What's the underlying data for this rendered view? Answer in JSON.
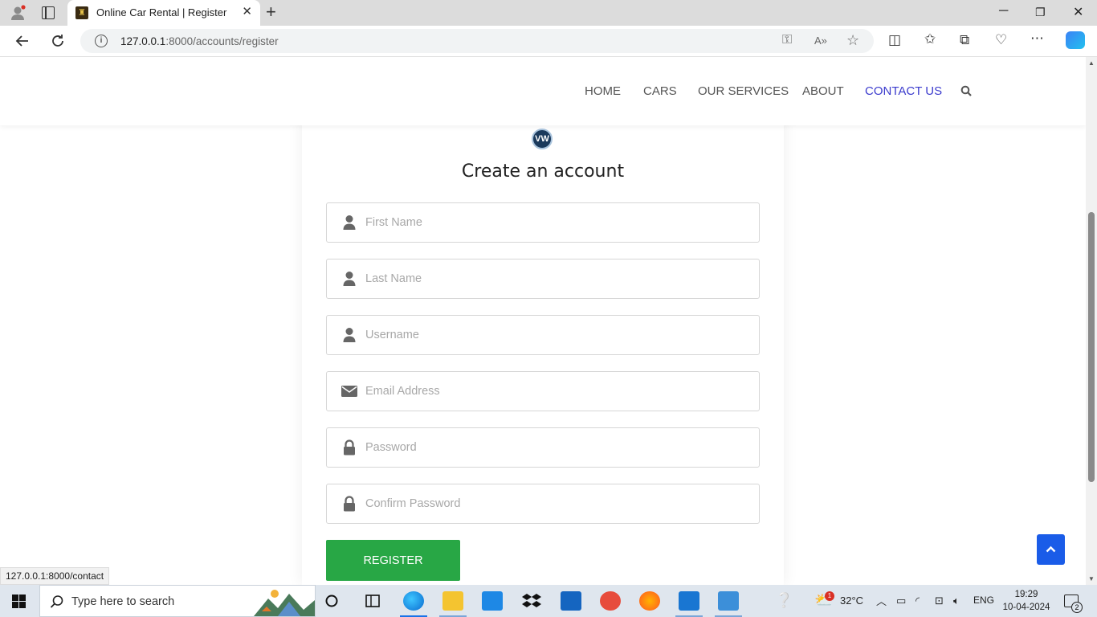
{
  "browser": {
    "tab_title": "Online Car Rental | Register",
    "tab_close": "✕",
    "new_tab": "+",
    "url_host": "127.0.0.1",
    "url_rest": ":8000/accounts/register",
    "status_url": "127.0.0.1:8000/contact"
  },
  "nav": {
    "items": [
      {
        "label": "HOME"
      },
      {
        "label": "CARS"
      },
      {
        "label": "OUR SERVICES"
      },
      {
        "label": "ABOUT"
      },
      {
        "label": "CONTACT US"
      }
    ]
  },
  "form": {
    "title": "Create an account",
    "fields": [
      {
        "placeholder": "First Name",
        "icon": "user-icon"
      },
      {
        "placeholder": "Last Name",
        "icon": "user-icon"
      },
      {
        "placeholder": "Username",
        "icon": "user-icon"
      },
      {
        "placeholder": "Email Address",
        "icon": "envelope-icon"
      },
      {
        "placeholder": "Password",
        "icon": "lock-icon"
      },
      {
        "placeholder": "Confirm Password",
        "icon": "lock-icon"
      }
    ],
    "submit_label": "REGISTER"
  },
  "taskbar": {
    "search_placeholder": "Type here to search",
    "temperature": "32°C",
    "language": "ENG",
    "time": "19:29",
    "date": "10-04-2024",
    "notification_count": "2",
    "weather_badge": "1"
  },
  "colors": {
    "accent": "#28a745",
    "nav_active": "#3b3bcd",
    "back_to_top": "#1a5ce8"
  }
}
